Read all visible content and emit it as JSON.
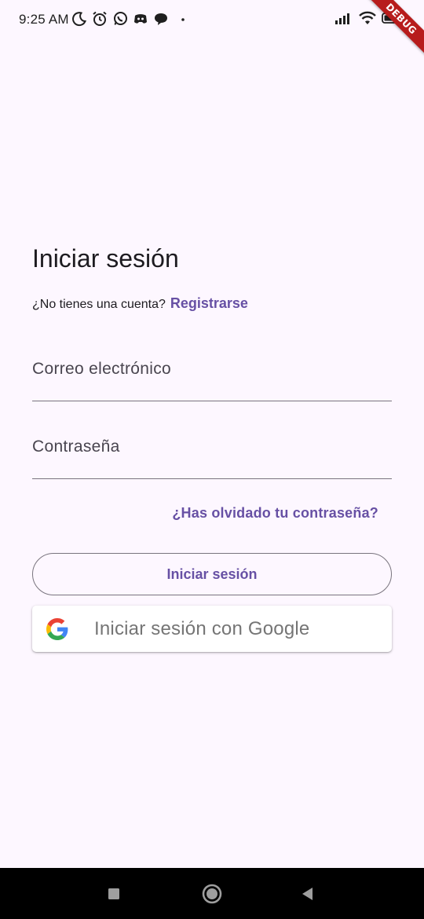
{
  "status_bar": {
    "time": "9:25 AM",
    "left_icons": [
      "moon-icon",
      "alarm-icon",
      "whatsapp-icon",
      "discord-icon",
      "chat-bubble-icon",
      "dot-icon"
    ],
    "right_icons": [
      "signal-icon",
      "wifi-icon",
      "battery-icon"
    ]
  },
  "debug_banner": "DEBUG",
  "login": {
    "title": "Iniciar sesión",
    "no_account_text": "¿No tienes una cuenta?",
    "register_link": "Registrarse",
    "email_placeholder": "Correo electrónico",
    "email_value": "",
    "password_placeholder": "Contraseña",
    "password_value": "",
    "forgot_password": "¿Has olvidado tu contraseña?",
    "login_button": "Iniciar sesión",
    "google_button": "Iniciar sesión con Google"
  },
  "navigation_bar": {
    "buttons": [
      "recent-apps-icon",
      "home-icon",
      "back-icon"
    ]
  },
  "colors": {
    "background": "#fdf7ff",
    "primary": "#6750a4",
    "outline": "#79747e",
    "text": "#1d1b20",
    "debug_banner": "#b71c1c"
  }
}
